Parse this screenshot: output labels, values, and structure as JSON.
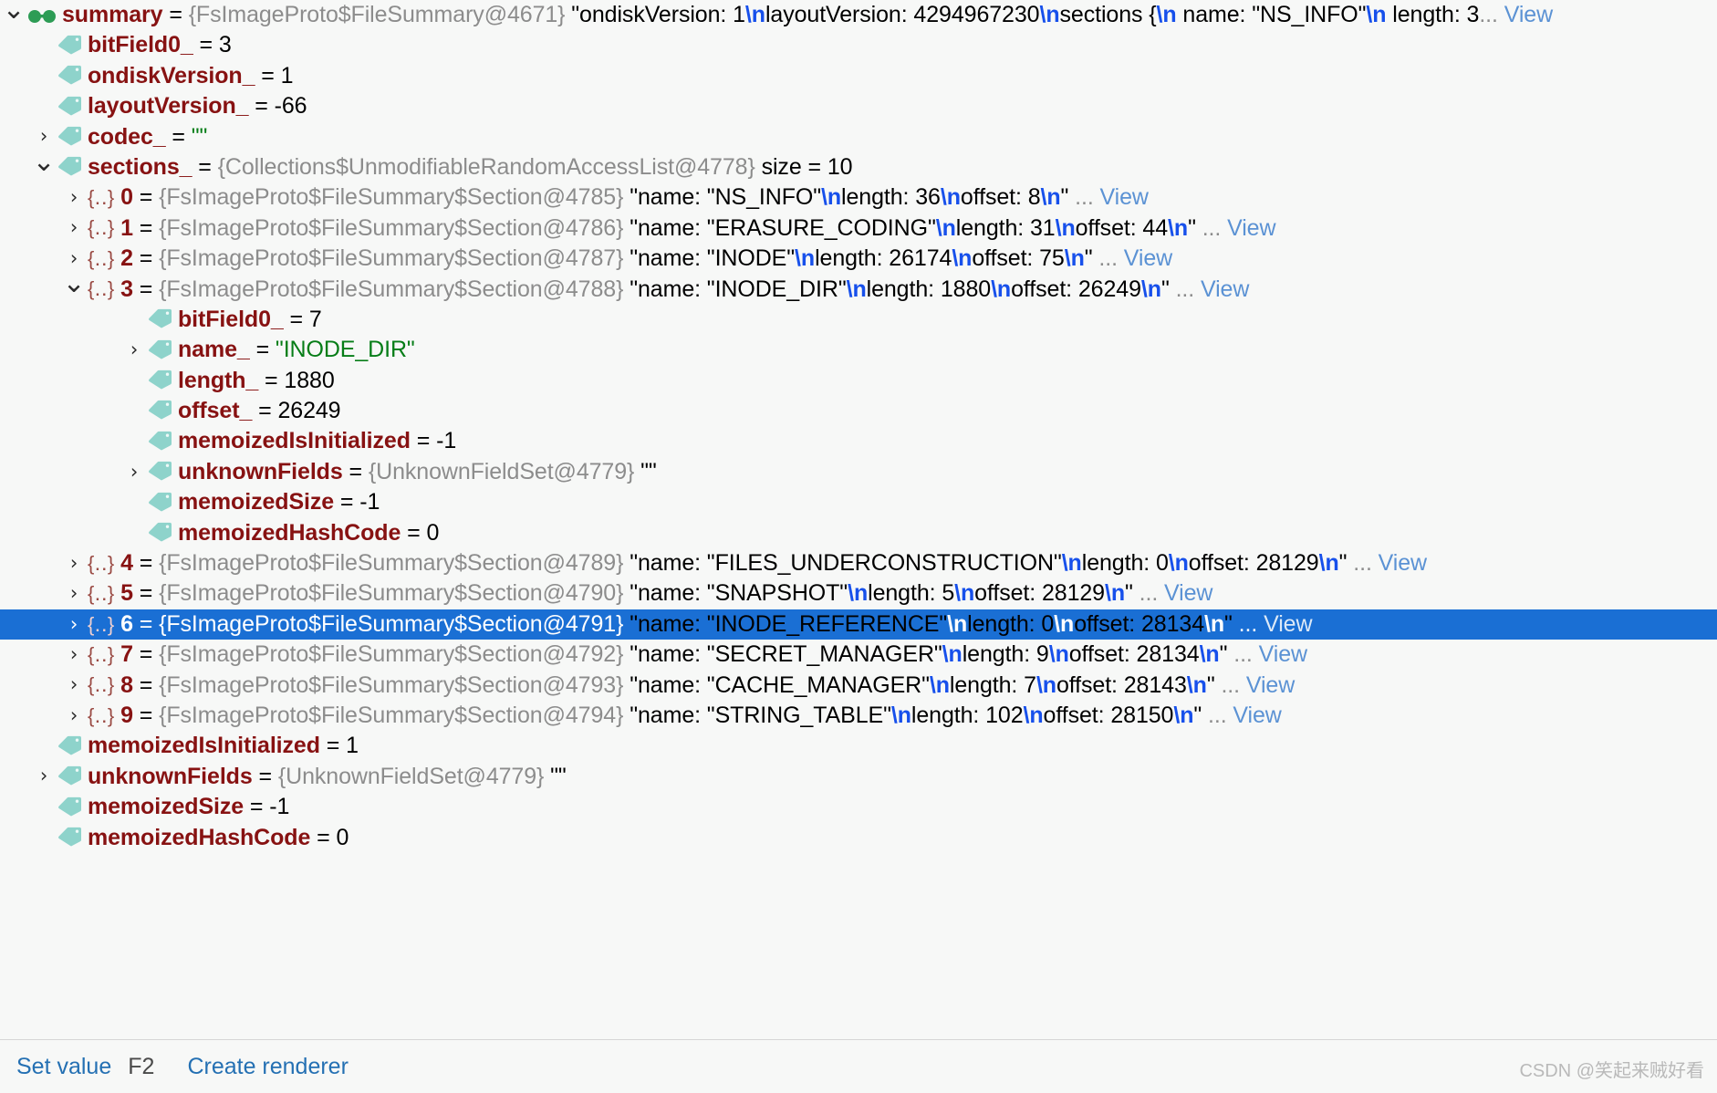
{
  "window": {
    "kind": "debugger-variables-tree",
    "selection_color": "#1a6fd4",
    "background": "#f7f8f7",
    "name_color": "#871212",
    "type_color": "#8c8c8c",
    "string_color": "#067d17",
    "escape_color": "#1750eb",
    "link_color": "#5b92d4"
  },
  "rows": [
    {
      "indent": 0,
      "arrow": "expanded",
      "icon": "glasses-icon",
      "name": "summary",
      "eq": " = ",
      "type": "{FsImageProto$FileSummary@4671}",
      "segments": [
        {
          "t": "quoted",
          "v": " \"ondiskVersion: 1"
        },
        {
          "t": "esc",
          "v": "\\n"
        },
        {
          "t": "quoted",
          "v": "layoutVersion: 4294967230"
        },
        {
          "t": "esc",
          "v": "\\n"
        },
        {
          "t": "quoted",
          "v": "sections {"
        },
        {
          "t": "esc",
          "v": "\\n"
        },
        {
          "t": "quoted",
          "v": "  name: \"NS_INFO\""
        },
        {
          "t": "esc",
          "v": "\\n"
        },
        {
          "t": "quoted",
          "v": "  length: 3"
        },
        {
          "t": "ellipsis",
          "v": "..."
        },
        {
          "t": "view",
          "v": " View"
        }
      ]
    },
    {
      "indent": 1,
      "arrow": "none",
      "icon": "tag-icon",
      "name": "bitField0_",
      "eq": " = ",
      "segments": [
        {
          "t": "val",
          "v": "3"
        }
      ]
    },
    {
      "indent": 1,
      "arrow": "none",
      "icon": "tag-icon",
      "name": "ondiskVersion_",
      "eq": " = ",
      "segments": [
        {
          "t": "val",
          "v": "1"
        }
      ]
    },
    {
      "indent": 1,
      "arrow": "none",
      "icon": "tag-icon",
      "name": "layoutVersion_",
      "eq": " = ",
      "segments": [
        {
          "t": "val",
          "v": "-66"
        }
      ]
    },
    {
      "indent": 1,
      "arrow": "collapsed",
      "icon": "tag-icon",
      "name": "codec_",
      "eq": " = ",
      "segments": [
        {
          "t": "strval",
          "v": "\"\""
        }
      ]
    },
    {
      "indent": 1,
      "arrow": "expanded",
      "icon": "tag-icon",
      "name": "sections_",
      "eq": " = ",
      "type": "{Collections$UnmodifiableRandomAccessList@4778}",
      "segments": [
        {
          "t": "size",
          "v": "  size = 10"
        }
      ]
    },
    {
      "indent": 2,
      "arrow": "collapsed",
      "icon": "brace-icon",
      "index": "0",
      "eq": " = ",
      "type": "{FsImageProto$FileSummary$Section@4785}",
      "segments": [
        {
          "t": "quoted",
          "v": " \"name: \"NS_INFO\""
        },
        {
          "t": "esc",
          "v": "\\n"
        },
        {
          "t": "quoted",
          "v": "length: 36"
        },
        {
          "t": "esc",
          "v": "\\n"
        },
        {
          "t": "quoted",
          "v": "offset: 8"
        },
        {
          "t": "esc",
          "v": "\\n"
        },
        {
          "t": "quoted",
          "v": "\""
        },
        {
          "t": "ellipsis",
          "v": " ..."
        },
        {
          "t": "view",
          "v": " View"
        }
      ]
    },
    {
      "indent": 2,
      "arrow": "collapsed",
      "icon": "brace-icon",
      "index": "1",
      "eq": " = ",
      "type": "{FsImageProto$FileSummary$Section@4786}",
      "segments": [
        {
          "t": "quoted",
          "v": " \"name: \"ERASURE_CODING\""
        },
        {
          "t": "esc",
          "v": "\\n"
        },
        {
          "t": "quoted",
          "v": "length: 31"
        },
        {
          "t": "esc",
          "v": "\\n"
        },
        {
          "t": "quoted",
          "v": "offset: 44"
        },
        {
          "t": "esc",
          "v": "\\n"
        },
        {
          "t": "quoted",
          "v": "\""
        },
        {
          "t": "ellipsis",
          "v": " ..."
        },
        {
          "t": "view",
          "v": " View"
        }
      ]
    },
    {
      "indent": 2,
      "arrow": "collapsed",
      "icon": "brace-icon",
      "index": "2",
      "eq": " = ",
      "type": "{FsImageProto$FileSummary$Section@4787}",
      "segments": [
        {
          "t": "quoted",
          "v": " \"name: \"INODE\""
        },
        {
          "t": "esc",
          "v": "\\n"
        },
        {
          "t": "quoted",
          "v": "length: 26174"
        },
        {
          "t": "esc",
          "v": "\\n"
        },
        {
          "t": "quoted",
          "v": "offset: 75"
        },
        {
          "t": "esc",
          "v": "\\n"
        },
        {
          "t": "quoted",
          "v": "\""
        },
        {
          "t": "ellipsis",
          "v": " ..."
        },
        {
          "t": "view",
          "v": " View"
        }
      ]
    },
    {
      "indent": 2,
      "arrow": "expanded",
      "icon": "brace-icon",
      "index": "3",
      "eq": " = ",
      "type": "{FsImageProto$FileSummary$Section@4788}",
      "segments": [
        {
          "t": "quoted",
          "v": " \"name: \"INODE_DIR\""
        },
        {
          "t": "esc",
          "v": "\\n"
        },
        {
          "t": "quoted",
          "v": "length: 1880"
        },
        {
          "t": "esc",
          "v": "\\n"
        },
        {
          "t": "quoted",
          "v": "offset: 26249"
        },
        {
          "t": "esc",
          "v": "\\n"
        },
        {
          "t": "quoted",
          "v": "\""
        },
        {
          "t": "ellipsis",
          "v": " ..."
        },
        {
          "t": "view",
          "v": " View"
        }
      ]
    },
    {
      "indent": 4,
      "arrow": "none",
      "icon": "tag-icon",
      "name": "bitField0_",
      "eq": " = ",
      "segments": [
        {
          "t": "val",
          "v": "7"
        }
      ]
    },
    {
      "indent": 4,
      "arrow": "collapsed",
      "icon": "tag-icon",
      "name": "name_",
      "eq": " = ",
      "segments": [
        {
          "t": "strval",
          "v": "\"INODE_DIR\""
        }
      ]
    },
    {
      "indent": 4,
      "arrow": "none",
      "icon": "tag-icon",
      "name": "length_",
      "eq": " = ",
      "segments": [
        {
          "t": "val",
          "v": "1880"
        }
      ]
    },
    {
      "indent": 4,
      "arrow": "none",
      "icon": "tag-icon",
      "name": "offset_",
      "eq": " = ",
      "segments": [
        {
          "t": "val",
          "v": "26249"
        }
      ]
    },
    {
      "indent": 4,
      "arrow": "none",
      "icon": "tag-icon",
      "name": "memoizedIsInitialized",
      "eq": " = ",
      "segments": [
        {
          "t": "val",
          "v": "-1"
        }
      ]
    },
    {
      "indent": 4,
      "arrow": "collapsed",
      "icon": "tag-icon",
      "name": "unknownFields",
      "eq": " = ",
      "type": "{UnknownFieldSet@4779}",
      "segments": [
        {
          "t": "quoted",
          "v": " \"\""
        }
      ]
    },
    {
      "indent": 4,
      "arrow": "none",
      "icon": "tag-icon",
      "name": "memoizedSize",
      "eq": " = ",
      "segments": [
        {
          "t": "val",
          "v": "-1"
        }
      ]
    },
    {
      "indent": 4,
      "arrow": "none",
      "icon": "tag-icon",
      "name": "memoizedHashCode",
      "eq": " = ",
      "segments": [
        {
          "t": "val",
          "v": "0"
        }
      ]
    },
    {
      "indent": 2,
      "arrow": "collapsed",
      "icon": "brace-icon",
      "index": "4",
      "eq": " = ",
      "type": "{FsImageProto$FileSummary$Section@4789}",
      "segments": [
        {
          "t": "quoted",
          "v": " \"name: \"FILES_UNDERCONSTRUCTION\""
        },
        {
          "t": "esc",
          "v": "\\n"
        },
        {
          "t": "quoted",
          "v": "length: 0"
        },
        {
          "t": "esc",
          "v": "\\n"
        },
        {
          "t": "quoted",
          "v": "offset: 28129"
        },
        {
          "t": "esc",
          "v": "\\n"
        },
        {
          "t": "quoted",
          "v": "\""
        },
        {
          "t": "ellipsis",
          "v": " ..."
        },
        {
          "t": "view",
          "v": " View"
        }
      ]
    },
    {
      "indent": 2,
      "arrow": "collapsed",
      "icon": "brace-icon",
      "index": "5",
      "eq": " = ",
      "type": "{FsImageProto$FileSummary$Section@4790}",
      "segments": [
        {
          "t": "quoted",
          "v": " \"name: \"SNAPSHOT\""
        },
        {
          "t": "esc",
          "v": "\\n"
        },
        {
          "t": "quoted",
          "v": "length: 5"
        },
        {
          "t": "esc",
          "v": "\\n"
        },
        {
          "t": "quoted",
          "v": "offset: 28129"
        },
        {
          "t": "esc",
          "v": "\\n"
        },
        {
          "t": "quoted",
          "v": "\""
        },
        {
          "t": "ellipsis",
          "v": " ..."
        },
        {
          "t": "view",
          "v": " View"
        }
      ]
    },
    {
      "indent": 2,
      "arrow": "collapsed",
      "icon": "brace-icon",
      "index": "6",
      "eq": " = ",
      "selected": true,
      "type": "{FsImageProto$FileSummary$Section@4791}",
      "segments": [
        {
          "t": "quoted",
          "v": " \"name: \"INODE_REFERENCE\""
        },
        {
          "t": "esc",
          "v": "\\n"
        },
        {
          "t": "quoted",
          "v": "length: 0"
        },
        {
          "t": "esc",
          "v": "\\n"
        },
        {
          "t": "quoted",
          "v": "offset: 28134"
        },
        {
          "t": "esc",
          "v": "\\n"
        },
        {
          "t": "quoted",
          "v": "\""
        },
        {
          "t": "ellipsis",
          "v": " ..."
        },
        {
          "t": "view",
          "v": " View"
        }
      ]
    },
    {
      "indent": 2,
      "arrow": "collapsed",
      "icon": "brace-icon",
      "index": "7",
      "eq": " = ",
      "type": "{FsImageProto$FileSummary$Section@4792}",
      "segments": [
        {
          "t": "quoted",
          "v": " \"name: \"SECRET_MANAGER\""
        },
        {
          "t": "esc",
          "v": "\\n"
        },
        {
          "t": "quoted",
          "v": "length: 9"
        },
        {
          "t": "esc",
          "v": "\\n"
        },
        {
          "t": "quoted",
          "v": "offset: 28134"
        },
        {
          "t": "esc",
          "v": "\\n"
        },
        {
          "t": "quoted",
          "v": "\""
        },
        {
          "t": "ellipsis",
          "v": " ..."
        },
        {
          "t": "view",
          "v": " View"
        }
      ]
    },
    {
      "indent": 2,
      "arrow": "collapsed",
      "icon": "brace-icon",
      "index": "8",
      "eq": " = ",
      "type": "{FsImageProto$FileSummary$Section@4793}",
      "segments": [
        {
          "t": "quoted",
          "v": " \"name: \"CACHE_MANAGER\""
        },
        {
          "t": "esc",
          "v": "\\n"
        },
        {
          "t": "quoted",
          "v": "length: 7"
        },
        {
          "t": "esc",
          "v": "\\n"
        },
        {
          "t": "quoted",
          "v": "offset: 28143"
        },
        {
          "t": "esc",
          "v": "\\n"
        },
        {
          "t": "quoted",
          "v": "\""
        },
        {
          "t": "ellipsis",
          "v": " ..."
        },
        {
          "t": "view",
          "v": " View"
        }
      ]
    },
    {
      "indent": 2,
      "arrow": "collapsed",
      "icon": "brace-icon",
      "index": "9",
      "eq": " = ",
      "type": "{FsImageProto$FileSummary$Section@4794}",
      "segments": [
        {
          "t": "quoted",
          "v": " \"name: \"STRING_TABLE\""
        },
        {
          "t": "esc",
          "v": "\\n"
        },
        {
          "t": "quoted",
          "v": "length: 102"
        },
        {
          "t": "esc",
          "v": "\\n"
        },
        {
          "t": "quoted",
          "v": "offset: 28150"
        },
        {
          "t": "esc",
          "v": "\\n"
        },
        {
          "t": "quoted",
          "v": "\""
        },
        {
          "t": "ellipsis",
          "v": " ..."
        },
        {
          "t": "view",
          "v": " View"
        }
      ]
    },
    {
      "indent": 1,
      "arrow": "none",
      "icon": "tag-icon",
      "name": "memoizedIsInitialized",
      "eq": " = ",
      "segments": [
        {
          "t": "val",
          "v": "1"
        }
      ]
    },
    {
      "indent": 1,
      "arrow": "collapsed",
      "icon": "tag-icon",
      "name": "unknownFields",
      "eq": " = ",
      "type": "{UnknownFieldSet@4779}",
      "segments": [
        {
          "t": "quoted",
          "v": " \"\""
        }
      ]
    },
    {
      "indent": 1,
      "arrow": "none",
      "icon": "tag-icon",
      "name": "memoizedSize",
      "eq": " = ",
      "segments": [
        {
          "t": "val",
          "v": "-1"
        }
      ]
    },
    {
      "indent": 1,
      "arrow": "none",
      "icon": "tag-icon",
      "name": "memoizedHashCode",
      "eq": " = ",
      "segments": [
        {
          "t": "val",
          "v": "0"
        }
      ]
    }
  ],
  "toolbar": {
    "set_value_label": "Set value",
    "set_value_shortcut": "F2",
    "create_renderer_label": "Create renderer"
  },
  "watermark": "CSDN @笑起来贼好看"
}
